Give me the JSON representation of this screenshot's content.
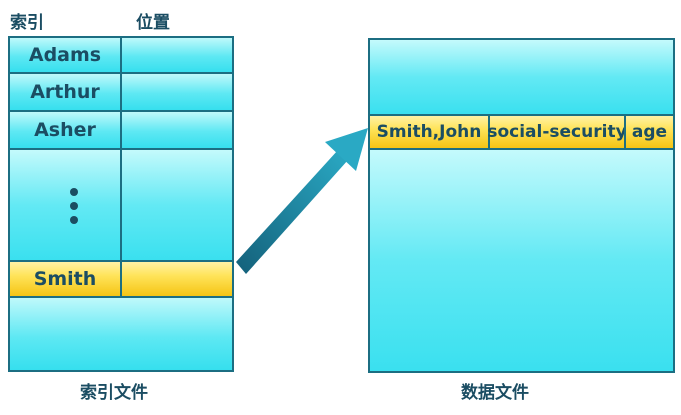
{
  "index_file": {
    "header_index": "索引",
    "header_position": "位置",
    "rows": [
      "Adams",
      "Arthur",
      "Asher"
    ],
    "highlight_row": "Smith",
    "caption": "索引文件"
  },
  "data_file": {
    "record_fields": [
      "Smith,John",
      "social-security",
      "age"
    ],
    "caption": "数据文件"
  },
  "colors": {
    "cyan_light": "#bff9fb",
    "cyan_dark": "#36dfee",
    "yellow": "#ffe45a",
    "border": "#1c6e82",
    "text": "#1b4d63",
    "arrow": "#1f8fa8"
  }
}
